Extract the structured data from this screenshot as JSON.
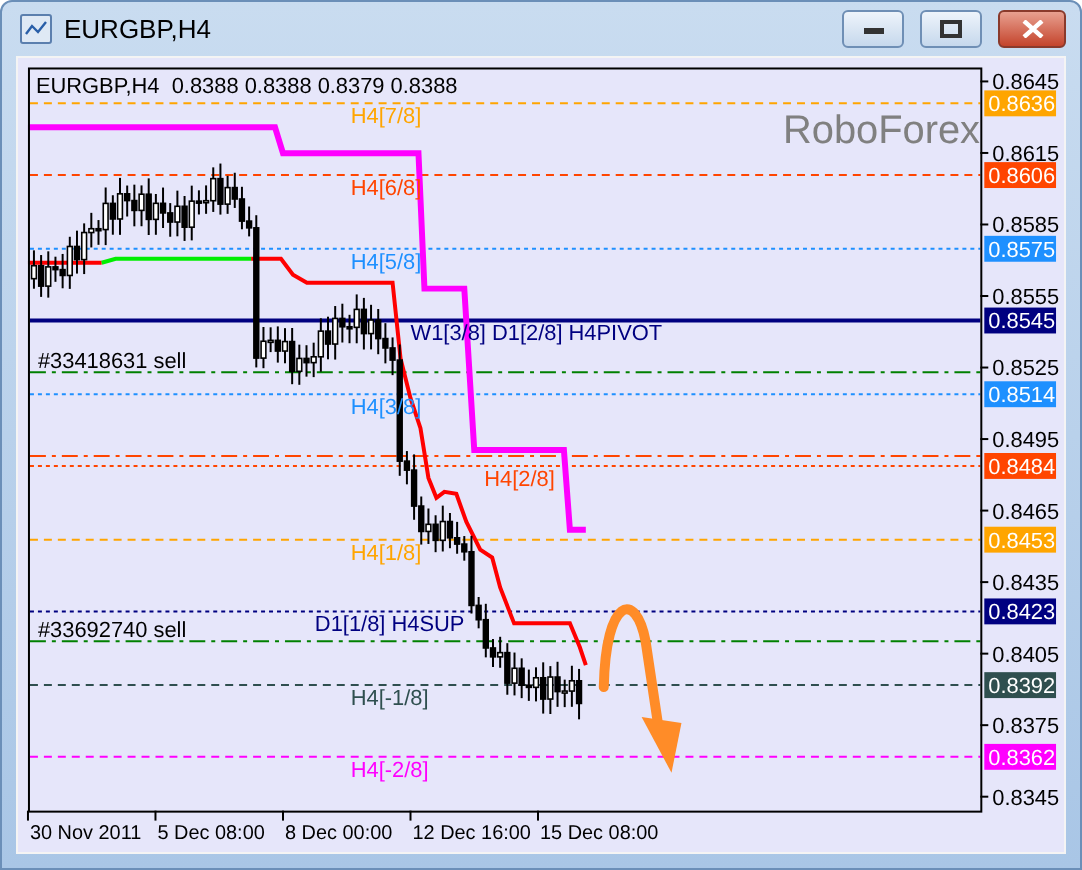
{
  "window": {
    "title": "EURGBP,H4"
  },
  "chart": {
    "header": "EURGBP,H4  0.8388 0.8388 0.8379 0.8388",
    "logo_text": "RoboForex",
    "levels": [
      {
        "label": "H4[7/8]",
        "tag": "0.8636",
        "color": "#ffa500",
        "kind": "dashed"
      },
      {
        "label": "H4[6/8]",
        "tag": "0.8606",
        "color": "#ff4500",
        "kind": "dashed"
      },
      {
        "label": "H4[5/8]",
        "tag": "0.8575",
        "color": "#1e90ff",
        "kind": "dotted"
      },
      {
        "label": "W1[3/8] D1[2/8] H4PIVOT",
        "tag": "0.8545",
        "color": "#000080",
        "kind": "solid"
      },
      {
        "label": "H4[3/8]",
        "tag": "0.8514",
        "color": "#1e90ff",
        "kind": "dotted"
      },
      {
        "label": "H4[2/8]",
        "tag": "0.8484",
        "color": "#ff4500",
        "kind": "dotted"
      },
      {
        "label": "H4[1/8]",
        "tag": "0.8453",
        "color": "#ffa500",
        "kind": "dashed"
      },
      {
        "label": "D1[1/8] H4SUP",
        "tag": "0.8423",
        "color": "#000080",
        "kind": "dotted"
      },
      {
        "label": "H4[-1/8]",
        "tag": "0.8392",
        "color": "#2f4f4f",
        "kind": "dashed"
      },
      {
        "label": "H4[-2/8]",
        "tag": "0.8362",
        "color": "#ff00ff",
        "kind": "dashed"
      }
    ],
    "orders": [
      {
        "label": "#33418631 sell"
      },
      {
        "label": "#33692740 sell"
      }
    ],
    "price_axis": [
      "0.8645",
      "0.8615",
      "0.8585",
      "0.8555",
      "0.8525",
      "0.8495",
      "0.8465",
      "0.8435",
      "0.8405",
      "0.8375",
      "0.8345"
    ],
    "time_axis": [
      "30 Nov 2011",
      "5 Dec 08:00",
      "8 Dec 00:00",
      "12 Dec 16:00",
      "15 Dec 08:00"
    ]
  }
}
